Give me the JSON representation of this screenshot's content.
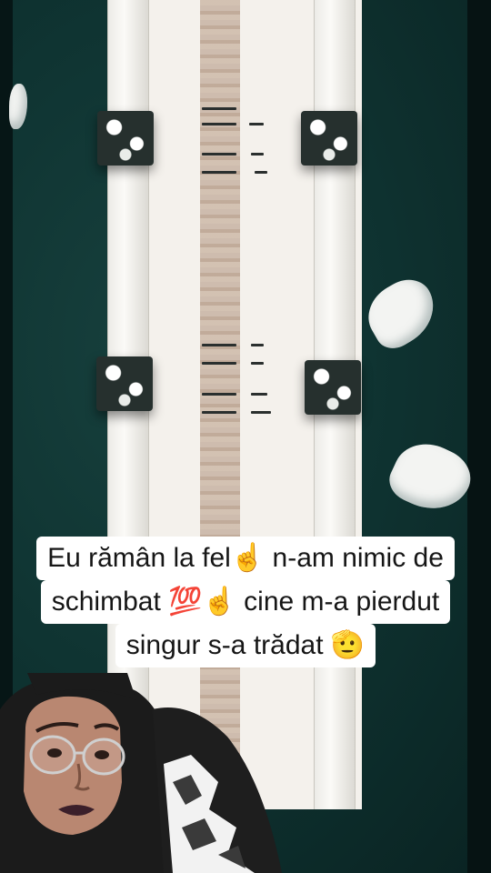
{
  "caption": {
    "line1": "Eu rămân la fel☝️ n-am nimic de",
    "line2": "schimbat 💯☝️ cine m-a pierdut",
    "line3": "singur s-a trădat 🫡"
  },
  "colors": {
    "water": "#0f3432",
    "bridge": "#f4f1ec",
    "path": "#c7b3a3",
    "caption_bg": "#ffffff",
    "caption_text": "#161616",
    "hijab": "#1b1b1b",
    "lips": "#3b1f2a"
  },
  "icons": [
    "cartoon-avatar"
  ]
}
